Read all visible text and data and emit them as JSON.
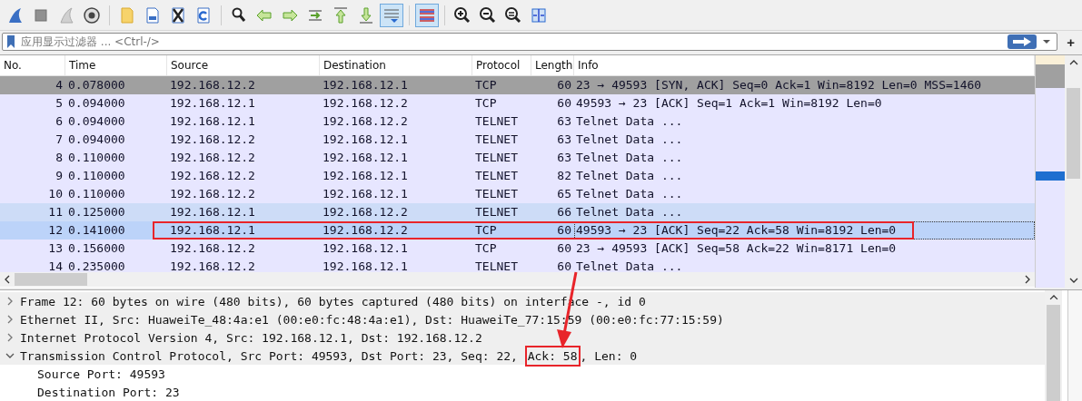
{
  "toolbar": [
    {
      "kind": "start",
      "pressed": false
    },
    {
      "kind": "stop",
      "pressed": false
    },
    {
      "kind": "restart",
      "pressed": false
    },
    {
      "kind": "options",
      "pressed": false
    },
    {
      "kind": "open",
      "pressed": false
    },
    {
      "kind": "save",
      "pressed": false
    },
    {
      "kind": "close",
      "pressed": false
    },
    {
      "kind": "reload",
      "pressed": false
    },
    {
      "kind": "find",
      "pressed": false
    },
    {
      "kind": "back",
      "pressed": false
    },
    {
      "kind": "forward",
      "pressed": false
    },
    {
      "kind": "goto",
      "pressed": false
    },
    {
      "kind": "first",
      "pressed": false
    },
    {
      "kind": "last",
      "pressed": false
    },
    {
      "kind": "autoscroll",
      "pressed": true
    },
    {
      "kind": "colorize",
      "pressed": true
    },
    {
      "kind": "zoom-in",
      "pressed": false
    },
    {
      "kind": "zoom-out",
      "pressed": false
    },
    {
      "kind": "zoom-reset",
      "pressed": false
    },
    {
      "kind": "resize",
      "pressed": false
    }
  ],
  "filter": {
    "placeholder": "应用显示过滤器 ... <Ctrl-/>",
    "add_label": "+"
  },
  "packet_list": {
    "columns": [
      "No.",
      "Time",
      "Source",
      "Destination",
      "Protocol",
      "Length",
      "Info"
    ],
    "rows": [
      {
        "no": "4",
        "time": "0.078000",
        "source": "192.168.12.2",
        "destination": "192.168.12.1",
        "protocol": "TCP",
        "length": "60",
        "info": "23 → 49593 [SYN, ACK] Seq=0 Ack=1 Win=8192 Len=0 MSS=1460",
        "color": "#a0a0a0",
        "selected": false,
        "marked": false
      },
      {
        "no": "5",
        "time": "0.094000",
        "source": "192.168.12.1",
        "destination": "192.168.12.2",
        "protocol": "TCP",
        "length": "60",
        "info": "49593 → 23 [ACK] Seq=1 Ack=1 Win=8192 Len=0",
        "color": "#e7e6ff",
        "selected": false,
        "marked": false
      },
      {
        "no": "6",
        "time": "0.094000",
        "source": "192.168.12.1",
        "destination": "192.168.12.2",
        "protocol": "TELNET",
        "length": "63",
        "info": "Telnet Data ...",
        "color": "#e7e6ff",
        "selected": false,
        "marked": false
      },
      {
        "no": "7",
        "time": "0.094000",
        "source": "192.168.12.2",
        "destination": "192.168.12.1",
        "protocol": "TELNET",
        "length": "63",
        "info": "Telnet Data ...",
        "color": "#e7e6ff",
        "selected": false,
        "marked": false
      },
      {
        "no": "8",
        "time": "0.110000",
        "source": "192.168.12.2",
        "destination": "192.168.12.1",
        "protocol": "TELNET",
        "length": "63",
        "info": "Telnet Data ...",
        "color": "#e7e6ff",
        "selected": false,
        "marked": false
      },
      {
        "no": "9",
        "time": "0.110000",
        "source": "192.168.12.2",
        "destination": "192.168.12.1",
        "protocol": "TELNET",
        "length": "82",
        "info": "Telnet Data ...",
        "color": "#e7e6ff",
        "selected": false,
        "marked": false
      },
      {
        "no": "10",
        "time": "0.110000",
        "source": "192.168.12.2",
        "destination": "192.168.12.1",
        "protocol": "TELNET",
        "length": "65",
        "info": "Telnet Data ...",
        "color": "#e7e6ff",
        "selected": false,
        "marked": false
      },
      {
        "no": "11",
        "time": "0.125000",
        "source": "192.168.12.1",
        "destination": "192.168.12.2",
        "protocol": "TELNET",
        "length": "66",
        "info": "Telnet Data ...",
        "color": "#cddcf7",
        "selected": false,
        "marked": false
      },
      {
        "no": "12",
        "time": "0.141000",
        "source": "192.168.12.1",
        "destination": "192.168.12.2",
        "protocol": "TCP",
        "length": "60",
        "info": "49593 → 23 [ACK] Seq=22 Ack=58 Win=8192 Len=0",
        "selected": true,
        "marked": true
      },
      {
        "no": "13",
        "time": "0.156000",
        "source": "192.168.12.2",
        "destination": "192.168.12.1",
        "protocol": "TCP",
        "length": "60",
        "info": "23 → 49593 [ACK] Seq=58 Ack=22 Win=8171 Len=0",
        "color": "#e7e6ff",
        "selected": false,
        "marked": false
      },
      {
        "no": "14",
        "time": "0.235000",
        "source": "192.168.12.2",
        "destination": "192.168.12.1",
        "protocol": "TELNET",
        "length": "60",
        "info": "Telnet Data ...",
        "color": "#e7e6ff",
        "selected": false,
        "marked": false
      }
    ]
  },
  "packet_details": [
    {
      "expanded": false,
      "parts": [
        {
          "text": "Frame 12: 60 bytes on wire (480 bits), 60 bytes captured (480 bits) on interface -, id 0",
          "marked": false
        }
      ]
    },
    {
      "expanded": false,
      "parts": [
        {
          "text": "Ethernet II, Src: HuaweiTe_48:4a:e1 (00:e0:fc:48:4a:e1), Dst: HuaweiTe_77:15:59 (00:e0:fc:77:15:59)",
          "marked": false
        }
      ]
    },
    {
      "expanded": false,
      "parts": [
        {
          "text": "Internet Protocol Version 4, Src: 192.168.12.1, Dst: 192.168.12.2",
          "marked": false
        }
      ]
    },
    {
      "expanded": true,
      "parts": [
        {
          "text": "Transmission Control Protocol, Src Port: 49593, Dst Port: 23, Seq: 22, ",
          "marked": false
        },
        {
          "text": "Ack: 58",
          "marked": true
        },
        {
          "text": ", Len: 0",
          "marked": false
        }
      ],
      "children": [
        {
          "text": "Source Port: 49593"
        },
        {
          "text": "Destination Port: 23"
        }
      ]
    }
  ]
}
